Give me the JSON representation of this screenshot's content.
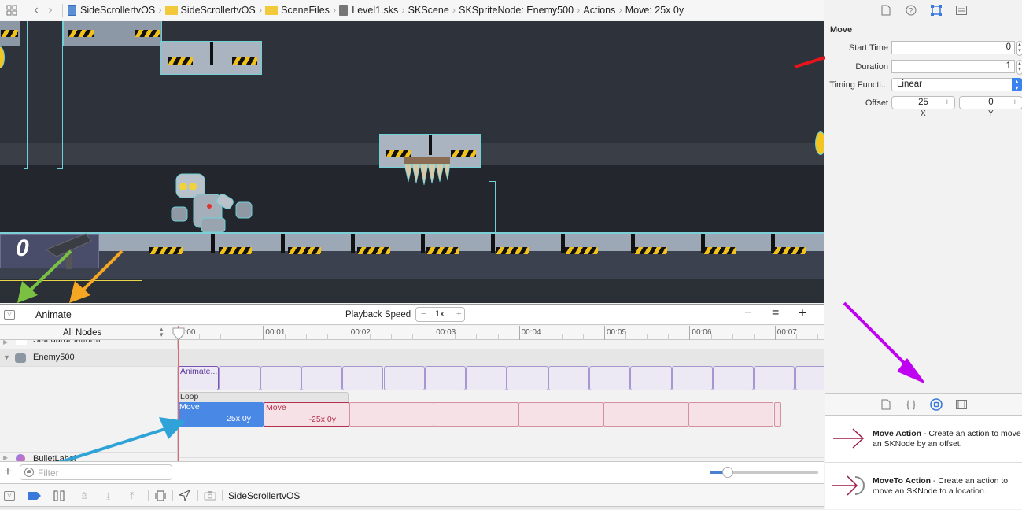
{
  "jumpbar": {
    "crumbs": [
      {
        "label": "SideScrollertvOS",
        "icon": "project-icon"
      },
      {
        "label": "SideScrollertvOS",
        "icon": "folder-icon"
      },
      {
        "label": "SceneFiles",
        "icon": "folder-icon"
      },
      {
        "label": "Level1.sks",
        "icon": "sks-file-icon"
      },
      {
        "label": "SKScene",
        "icon": ""
      },
      {
        "label": "SKSpriteNode: Enemy500",
        "icon": ""
      },
      {
        "label": "Actions",
        "icon": ""
      },
      {
        "label": "Move: 25x 0y",
        "icon": ""
      }
    ]
  },
  "scene": {
    "score_label": "0"
  },
  "inspector": {
    "section_title": "Move",
    "start_time_label": "Start Time",
    "start_time_value": "0",
    "duration_label": "Duration",
    "duration_value": "1",
    "timing_label": "Timing Functi...",
    "timing_value": "Linear",
    "offset_label": "Offset",
    "offset_x": "25",
    "offset_y": "0",
    "x_label": "X",
    "y_label": "Y",
    "minus": "−",
    "plus": "+"
  },
  "library": {
    "items": [
      {
        "title": "Move Action",
        "desc": " - Create an action to move an SKNode by an offset."
      },
      {
        "title": "MoveTo Action",
        "desc": " - Create an action to move an SKNode to a location."
      }
    ]
  },
  "animbar": {
    "title": "Animate",
    "playback_label": "Playback Speed",
    "speed_value": "1x",
    "minus": "−",
    "plus": "+",
    "zoom_out": "−",
    "zoom_fit": "=",
    "zoom_in": "+"
  },
  "timeline": {
    "node_filter": "All Nodes",
    "ticks": [
      "0:00",
      "00:01",
      "00:02",
      "00:03",
      "00:04",
      "00:05",
      "00:06",
      "00:07"
    ],
    "nodes": [
      {
        "name": "StandardPlatform",
        "expanded": false
      },
      {
        "name": "Enemy500",
        "expanded": true
      },
      {
        "name": "BulletLabel",
        "expanded": false
      }
    ],
    "animate_action_label": "Animate...",
    "loop_label": "Loop",
    "move1_label": "Move",
    "move1_value": "25x 0y",
    "move2_label": "Move",
    "move2_value": "-25x 0y"
  },
  "filterbar": {
    "add": "+",
    "filter_placeholder": "Filter",
    "zoom_slider_fraction": 0.17
  },
  "debugbar": {
    "target": "SideScrollertvOS"
  },
  "annotations": {
    "arrow_colors": [
      "#e8141c",
      "#7ac143",
      "#f5a623",
      "#2fa3d8",
      "#c000f0"
    ]
  }
}
